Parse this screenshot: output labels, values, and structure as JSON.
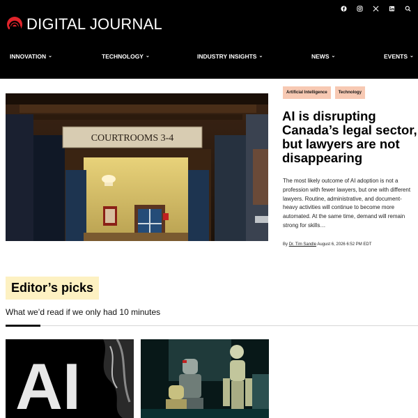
{
  "header": {
    "logo_text": "DIGITAL JOURNAL",
    "social_icons": [
      "facebook-icon",
      "instagram-icon",
      "x-icon",
      "linkedin-icon",
      "search-icon"
    ],
    "nav": [
      {
        "label": "INNOVATION"
      },
      {
        "label": "TECHNOLOGY"
      },
      {
        "label": "INDUSTRY INSIGHTS"
      },
      {
        "label": "NEWS"
      },
      {
        "label": "EVENTS"
      }
    ]
  },
  "hero": {
    "image_text": "COURTROOMS 3-4",
    "tags": [
      "Artificial Intelligence",
      "Technology"
    ],
    "headline": "AI is disrupting Canada’s legal sector, but lawyers are not disappearing",
    "summary": "The most likely outcome of AI adoption is not a profession with fewer lawyers, but one with different lawyers. Routine, administrative, and document-heavy activities will continue to become more automated. At the same time, demand will remain strong for skills…",
    "byline": {
      "prefix": "By",
      "author": "Dr. Tim Sandle",
      "date": "August 6, 2026 6:52 PM EDT"
    }
  },
  "editors_picks": {
    "title": "Editor’s picks",
    "subtitle": "What we’d read if we only had 10 minutes",
    "card_1_image_text": "AI"
  },
  "colors": {
    "header_bg": "#000000",
    "logo_red": "#e0242b",
    "tag_bg": "#f7c9b3",
    "picks_title_bg": "#fdf1c2"
  }
}
